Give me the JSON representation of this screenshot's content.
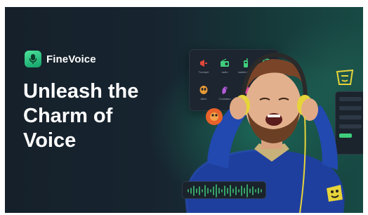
{
  "brand": {
    "name": "FineVoice",
    "icon": "microphone-icon",
    "accent": "#2fd18a"
  },
  "headline": {
    "line1": "Unleash the",
    "line2": "Charm of",
    "line3": "Voice"
  },
  "app_panel": {
    "tiles": [
      {
        "label": "Trumpet",
        "icon": "megaphone-icon",
        "color": "#e0483c"
      },
      {
        "label": "radio",
        "icon": "radio-icon",
        "color": "#3fce7c"
      },
      {
        "label": "walkie-talkie",
        "icon": "walkie-talkie-icon",
        "color": "#3fce7c"
      },
      {
        "label": "",
        "icon": "target-icon",
        "color": "#3fce7c"
      },
      {
        "label": "Alien",
        "icon": "alien-icon",
        "color": "#e89a35"
      },
      {
        "label": "Cockatoo",
        "icon": "bird-icon",
        "color": "#b35ad8"
      }
    ]
  },
  "colors": {
    "background_dark": "#15202a",
    "background_teal": "#184a44",
    "sweater": "#1f3f9e",
    "headphones": "#e6d43a"
  }
}
